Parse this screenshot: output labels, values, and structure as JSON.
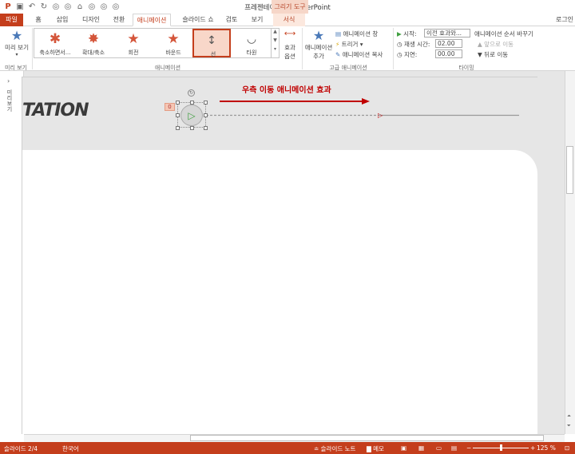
{
  "window": {
    "title": "프레젠테이션2 - PowerPoint",
    "context_tab": "그리기 도구",
    "signin": "로그인"
  },
  "tabs": [
    "파일",
    "홈",
    "삽입",
    "디자인",
    "전환",
    "애니메이션",
    "슬라이드 쇼",
    "검토",
    "보기",
    "서식"
  ],
  "ribbon": {
    "preview": {
      "label1": "미리 보기",
      "group": "미리 보기"
    },
    "gallery": [
      {
        "label": "축소하면서..."
      },
      {
        "label": "확대/축소"
      },
      {
        "label": "회전"
      },
      {
        "label": "바운드"
      },
      {
        "label": "선",
        "selected": true
      },
      {
        "label": "타원"
      }
    ],
    "effect_options": {
      "label1": "효과",
      "label2": "옵션"
    },
    "anim_group": "애니메이션",
    "add_anim": {
      "label1": "애니메이션",
      "label2": "추가"
    },
    "anim_pane": "애니메이션 창",
    "trigger": "트리거",
    "anim_painter": "애니메이션 복사",
    "adv_group": "고급 애니메이션",
    "timing": {
      "start_label": "시작:",
      "start_value": "이전 효과와...",
      "duration_label": "재생 시간:",
      "duration_value": "02.00",
      "delay_label": "지연:",
      "delay_value": "00.00",
      "reorder_title": "애니메이션 순서 바꾸기",
      "move_earlier": "앞으로 이동",
      "move_later": "뒤로 이동",
      "group": "타이밍"
    }
  },
  "left_panel": {
    "label": "미리보기"
  },
  "slide": {
    "title_fragment": "TATION",
    "caption": "우측 이동 애니메이션 효과",
    "anim_number": "0"
  },
  "status": {
    "slide": "슬라이드 2/4",
    "language": "한국어",
    "notes": "슬라이드 노트",
    "comments": "메모",
    "zoom": "125 %"
  },
  "colors": {
    "accent": "#c43e1c",
    "caption": "#c00000"
  }
}
